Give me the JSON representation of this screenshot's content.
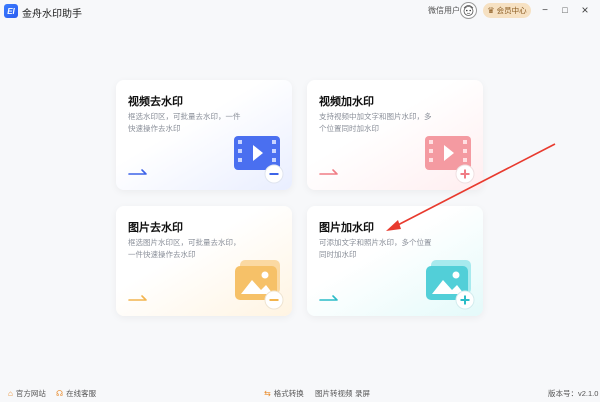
{
  "titlebar": {
    "logo_text": "EI",
    "title": "金舟水印助手",
    "user_name": "微信用户",
    "vip_label": "会员中心",
    "minimize": "−",
    "maximize": "□",
    "close": "×"
  },
  "cards": [
    {
      "title": "视频去水印",
      "desc": "框选水印区，可批量去水印，一件快速操作去水印",
      "accent": "#3d63e8",
      "badge": "minus"
    },
    {
      "title": "视频加水印",
      "desc": "支持视频中加文字和图片水印，多个位置同时加水印",
      "accent": "#f07c85",
      "badge": "plus"
    },
    {
      "title": "图片去水印",
      "desc": "框选图片水印区，可批量去水印，一件快速操作去水印",
      "accent": "#f2b44e",
      "badge": "minus"
    },
    {
      "title": "图片加水印",
      "desc": "可添加文字和照片水印，多个位置同时加水印",
      "accent": "#2bbcc7",
      "badge": "plus"
    }
  ],
  "footer": {
    "website": "官方网站",
    "support": "在线客服",
    "format_convert": "格式转换",
    "img_to_video": "图片转视频",
    "record": "录屏",
    "version": "版本号：v2.1.0"
  }
}
